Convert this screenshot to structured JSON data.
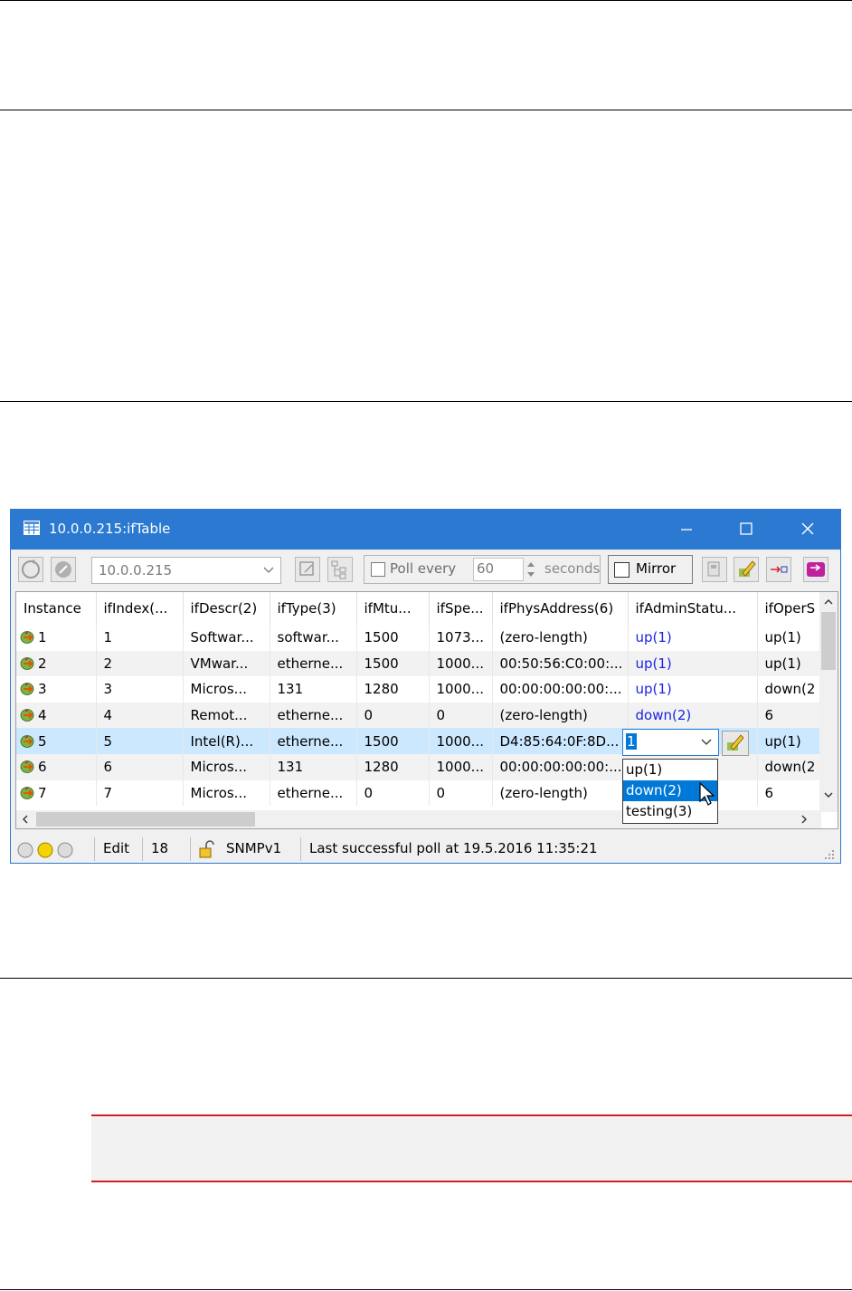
{
  "window": {
    "title": "10.0.0.215:ifTable"
  },
  "toolbar": {
    "address": "10.0.0.215",
    "poll_label": "Poll every",
    "poll_value": "60",
    "poll_unit": "seconds",
    "mirror_label": "Mirror"
  },
  "table": {
    "columns": [
      "Instance",
      "ifIndex(...",
      "ifDescr(2)",
      "ifType(3)",
      "ifMtu...",
      "ifSpe...",
      "ifPhysAddress(6)",
      "ifAdminStatu...",
      "ifOperS"
    ],
    "rows": [
      [
        "1",
        "1",
        "Softwar...",
        "softwar...",
        "1500",
        "1073...",
        "(zero-length)",
        "up(1)",
        "up(1)"
      ],
      [
        "2",
        "2",
        "VMwar...",
        "etherne...",
        "1500",
        "1000...",
        "00:50:56:C0:00:...",
        "up(1)",
        "up(1)"
      ],
      [
        "3",
        "3",
        "Micros...",
        "131",
        "1280",
        "1000...",
        "00:00:00:00:00:...",
        "up(1)",
        "down(2"
      ],
      [
        "4",
        "4",
        "Remot...",
        "etherne...",
        "0",
        "0",
        "(zero-length)",
        "down(2)",
        "6"
      ],
      [
        "5",
        "5",
        "Intel(R)...",
        "etherne...",
        "1500",
        "1000...",
        "D4:85:64:0F:8D...",
        "",
        "up(1)"
      ],
      [
        "6",
        "6",
        "Micros...",
        "131",
        "1280",
        "1000...",
        "00:00:00:00:00:...",
        "",
        "down(2"
      ],
      [
        "7",
        "7",
        "Micros...",
        "etherne...",
        "0",
        "0",
        "(zero-length)",
        "",
        "6"
      ]
    ]
  },
  "editor": {
    "value": "1",
    "options": [
      "up(1)",
      "down(2)",
      "testing(3)"
    ],
    "highlighted": "down(2)"
  },
  "statusbar": {
    "mode": "Edit",
    "count": "18",
    "protocol": "SNMPv1",
    "message": "Last successful poll at 19.5.2016 11:35:21"
  },
  "colors": {
    "titlebar": "#2b79d0",
    "selected_row": "#cce8ff",
    "editable_value": "#1a24e6",
    "highlight": "#0078d7",
    "note_border": "#d32020"
  }
}
